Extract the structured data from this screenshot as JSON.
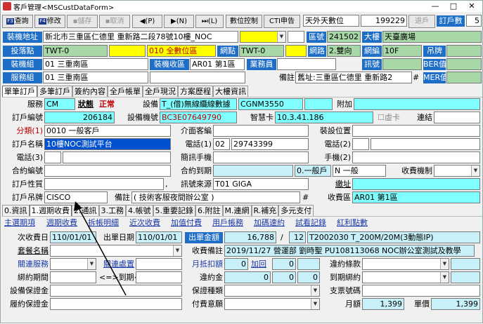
{
  "window": {
    "title": "客戶管理<MSCustDataForm>",
    "min": "—",
    "max": "□",
    "close": "✕"
  },
  "toolbar": {
    "query": "查詢",
    "query_key": "F3",
    "edit": "修改",
    "edit_key": "F4",
    "save": "儲存",
    "cancel": "取消",
    "prev": "(P)",
    "next": "(N)",
    "last": "(L)",
    "data_control": "數位控制",
    "cti": "CTI申告",
    "company": "天外天數位",
    "number": "199229",
    "back": "退戶",
    "order_count_label": "訂戶數",
    "order_count": "5"
  },
  "address": {
    "install_label": "裝機地址",
    "install_value": "新北市三重區仁德里 重新路二段78號10樓_NOC",
    "area_no_label": "區號",
    "area_no": "241502",
    "building_label": "大樓",
    "building": "天臺廣場",
    "point_label": "投落點",
    "point1": "TWT-0",
    "point2": "010 全數位區",
    "network_label": "網點",
    "network": "TWT-0",
    "net_path_label": "網路",
    "net_path": "2.雙向",
    "net_unit_label": "網編",
    "net_unit": "10F",
    "hang_label": "吊牌",
    "install_group_label": "裝機組",
    "install_group": "01 三重南區",
    "install_area_label": "裝機收區",
    "install_area": "AR01 第1區",
    "staff_label": "業務員",
    "signal_label": "訊號",
    "ber_label": "BER值",
    "service_group_label": "服務組",
    "service_group": "01 三重南區",
    "remark_label": "備註",
    "remark": "舊址:三重區仁德里 重新路2",
    "mer_label": "MER值",
    "hash": "#"
  },
  "tabs1": [
    "單筆訂戶",
    "多筆訂戶",
    "簽約內容",
    "全戶帳單",
    "全戶現況",
    "方案歷程",
    "大樓資訊"
  ],
  "order": {
    "service_label": "服務",
    "service": "CM",
    "status_label": "狀態",
    "status": "正常",
    "device_label": "設備",
    "device": "T_(借)無線纜線數據",
    "device_code": "CGNM3550",
    "extra_label": "附加",
    "order_no_label": "訂戶編號",
    "order_no": "206184",
    "box_label": "設備機號",
    "box": "BC3E07649790",
    "smart_label": "智慧卡",
    "smart": "10.3.41.186",
    "vcard_label": "虛卡",
    "link_label": "連結",
    "class_label": "分類(1)",
    "class": "0010 一般客戶",
    "media_label": "介面客編",
    "install_pos_label": "裝設位置",
    "name_label": "訂戶名稱",
    "name": "10樓NOC測試平台",
    "phone1_label": "電話(1)",
    "phone1_area": "02",
    "phone1": "29743399",
    "phone2_label": "電話(2)",
    "phone3_label": "電話(3)",
    "brief_label": "簡訊手機",
    "mobile_label": "手機(2)",
    "contract_label": "合約編號",
    "contract_end_label": "合約到期",
    "customer_type": "0.一般戶",
    "grade": "N 一般",
    "billing_label": "收費機制",
    "property_label": "訂戶性質",
    "source_label": "訊號來源",
    "source": "T01 GIGA",
    "mail_label": "繳址",
    "tag_label": "訂戶吊牌",
    "tag": "CISCO",
    "note_label": "備註",
    "note": "( 技術客服夜間辦公室 )",
    "charge_area_label": "收費區",
    "charge_area": "AR01 第1區",
    "hash": "#"
  },
  "tabs2": [
    "0.資訊",
    "1.週期收費",
    "2.通訊",
    "3.工務",
    "4.帳號",
    "5.重要記錄",
    "6.附註",
    "M.連網",
    "R.補充",
    "多元支付"
  ],
  "links": [
    "主選期項",
    "週期收費",
    "拆帳明細",
    "近次收費",
    "加值付費",
    "用戶帳務",
    "加碼速約",
    "試看記錄",
    "紅利點數"
  ],
  "billing": {
    "next_charge_label": "次收費日",
    "next_charge": "110/01/01",
    "out_label": "出單日期",
    "out_date": "110/01/01",
    "amount_label": "出單金額",
    "amount": "16,788",
    "slash": "/",
    "months": "12",
    "plan": "T2002030 T_200M/20M(3動態IP)",
    "package_label": "套餐名稱",
    "remark_label": "收費備註",
    "remark": "2019/11/27 營運部 劉時聖 PU108113068 NOC辦公室測試及教學",
    "service_label": "關連服務",
    "processing_label": "關連處置",
    "discount_label": "月抵扣額",
    "discount": "0",
    "add_label": "加回",
    "add": "0",
    "contract_terms_label": "違約條款",
    "period_label": "綁約期間",
    "period_to": "<=>到期<",
    "penalty_label": "違約金",
    "penalty1": "0",
    "penalty2": "0",
    "penalty3": "0",
    "bundle_label": "到期綁約",
    "deposit_label": "設備保證金",
    "deposit_type_label": "保證種類",
    "pay_no_label": "支票號碼",
    "perf_label": "履約保證金",
    "pay_method_label": "付費意願",
    "monthly_label": "月額",
    "monthly": "1,399",
    "unit_label": "單價",
    "unit": "1,399"
  }
}
